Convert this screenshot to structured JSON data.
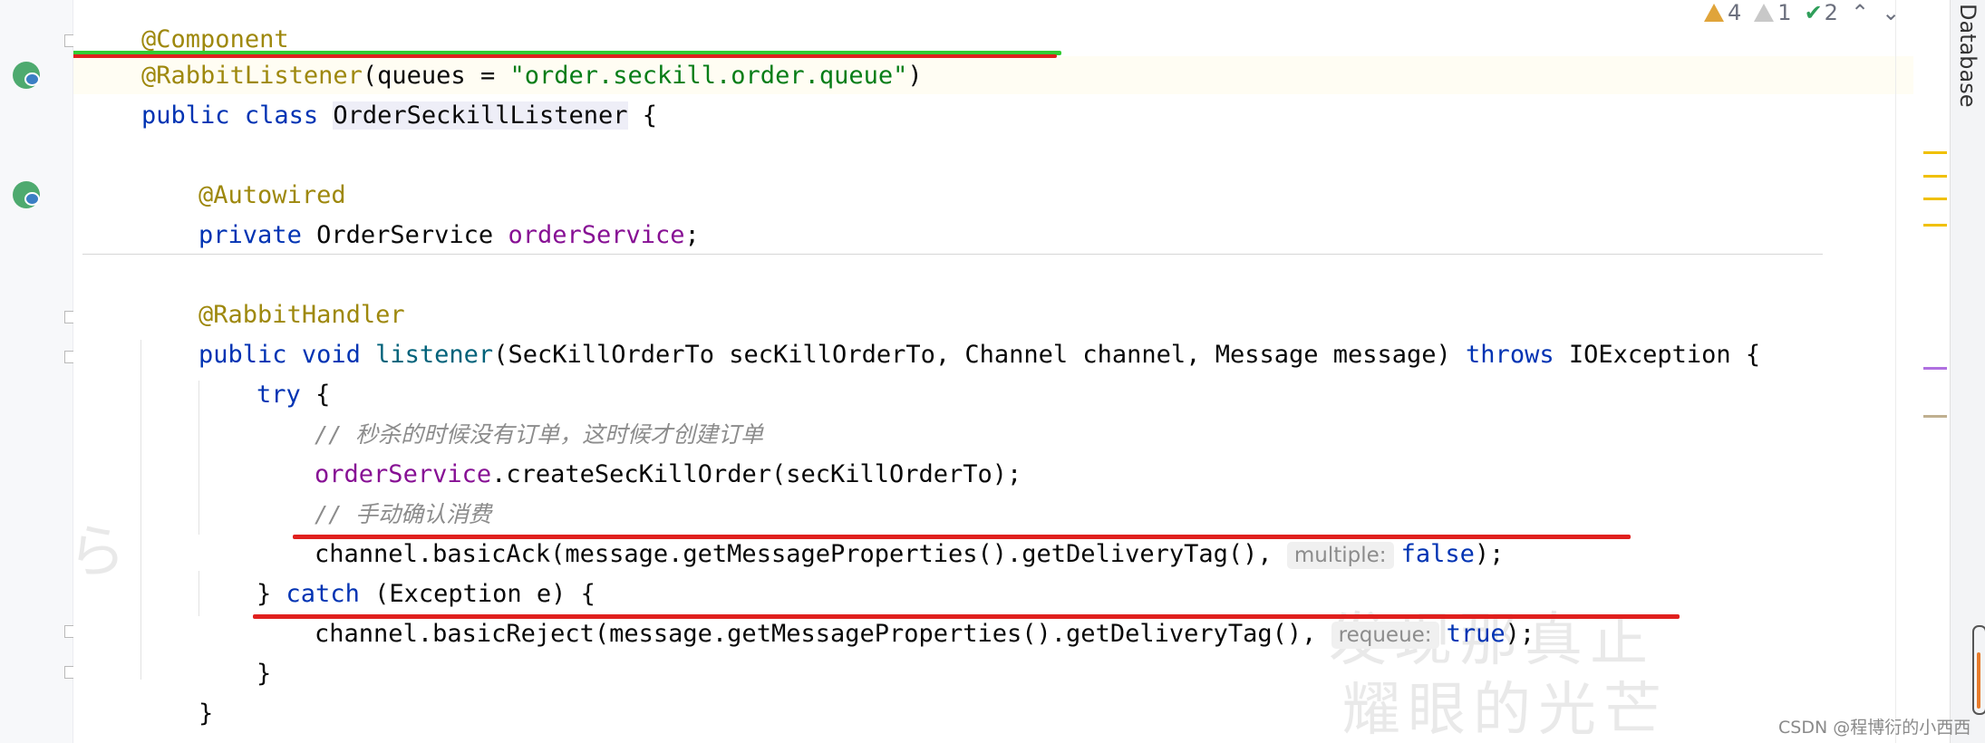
{
  "editor": {
    "lines": {
      "l0": {
        "annotation": "@Component"
      },
      "l1": {
        "annotation": "@RabbitListener",
        "open": "(",
        "param": "queues",
        "eq": " = ",
        "value": "\"order.seckill.order.queue\"",
        "close": ")"
      },
      "l2": {
        "kw1": "public",
        "kw2": "class",
        "name": "OrderSeckillListener",
        "brace": " {"
      },
      "l4": {
        "annotation": "@Autowired"
      },
      "l5": {
        "kw": "private",
        "type": "OrderService",
        "field": "orderService",
        "end": ";"
      },
      "l7": {
        "annotation": "@RabbitHandler"
      },
      "l8": {
        "kw1": "public",
        "kw2": "void",
        "method": "listener",
        "params": "(SecKillOrderTo secKillOrderTo, Channel channel, Message message) ",
        "throws": "throws",
        "exception": " IOException {"
      },
      "l9": {
        "kw": "try",
        "rest": " {"
      },
      "l10": {
        "comment": "// 秒杀的时候没有订单，这时候才创建订单"
      },
      "l11": {
        "field": "orderService",
        "rest": ".createSecKillOrder(secKillOrderTo);"
      },
      "l12": {
        "comment": "// 手动确认消费"
      },
      "l13": {
        "code": "channel.basicAck(message.getMessageProperties().getDeliveryTag(), ",
        "hint": "multiple:",
        "value": "false",
        "end": ");"
      },
      "l14": {
        "open": "} ",
        "kw": "catch",
        "rest": " (Exception e) {"
      },
      "l15": {
        "code": "channel.basicReject(message.getMessageProperties().getDeliveryTag(), ",
        "hint": "requeue:",
        "value": "true",
        "end": ");"
      },
      "l16": {
        "text": "}"
      },
      "l17": {
        "text": "}"
      }
    }
  },
  "inspections": {
    "warnings": "4",
    "weak_warnings": "1",
    "ok": "2",
    "up_icon": "chevron-up-icon",
    "down_icon": "chevron-down-icon"
  },
  "sidebar": {
    "label": "Database"
  },
  "watermark": {
    "line1": "发现那真正",
    "line2": "耀眼的光芒",
    "left": "こ\nたら"
  },
  "credit": "CSDN @程博衍的小西西",
  "colors": {
    "keyword": "#0033b3",
    "annotation": "#9e880d",
    "string": "#067d17",
    "field": "#871094",
    "method": "#00627a",
    "comment": "#8c8c8c",
    "red_underline": "#e0201e",
    "green_underline": "#33cc33"
  }
}
